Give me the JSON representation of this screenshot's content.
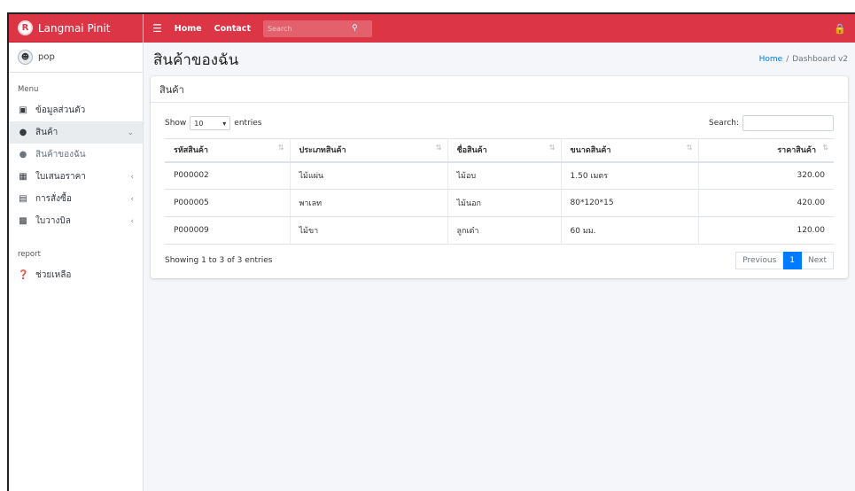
{
  "brand": {
    "logo_letter": "R",
    "name": "Langmai Pinit"
  },
  "user": {
    "name": "pop"
  },
  "sidebar": {
    "menu_header": "Menu",
    "items": [
      {
        "label": "ข้อมูลส่วนตัว",
        "icon": "id-card-icon"
      },
      {
        "label": "สินค้า",
        "icon": "circle-icon"
      },
      {
        "label": "สินค้าของฉัน",
        "icon": "circle-icon"
      },
      {
        "label": "ใบเสนอราคา",
        "icon": "calendar-icon"
      },
      {
        "label": "การสั่งซื้อ",
        "icon": "address-card-icon"
      },
      {
        "label": "ใบวางบิล",
        "icon": "file-icon"
      }
    ],
    "report_header": "report",
    "report_items": [
      {
        "label": "ช่วยเหลือ",
        "icon": "question-circle-icon"
      }
    ]
  },
  "topbar": {
    "home": "Home",
    "contact": "Contact",
    "search_placeholder": "Search"
  },
  "page": {
    "title": "สินค้าของฉัน",
    "breadcrumb_home": "Home",
    "breadcrumb_current": "Dashboard v2"
  },
  "card": {
    "title": "สินค้า"
  },
  "datatable": {
    "show_label": "Show",
    "entries_value": "10",
    "entries_label": "entries",
    "search_label": "Search:",
    "columns": [
      "รหัสสินค้า",
      "ประเภทสินค้า",
      "ชื่อสินค้า",
      "ขนาดสินค้า",
      "ราคาสินค้า"
    ],
    "rows": [
      [
        "P000002",
        "ไม้แผ่น",
        "ไม้อบ",
        "1.50 เมตร",
        "320.00"
      ],
      [
        "P000005",
        "พาเลท",
        "ไม้นอก",
        "80*120*15",
        "420.00"
      ],
      [
        "P000009",
        "ไม้ขา",
        "ลูกเต๋า",
        "60 มม.",
        "120.00"
      ]
    ],
    "info": "Showing 1 to 3 of 3 entries",
    "prev": "Previous",
    "page": "1",
    "next": "Next"
  },
  "colors": {
    "brand_red": "#dc3545",
    "link_blue": "#007bff"
  }
}
